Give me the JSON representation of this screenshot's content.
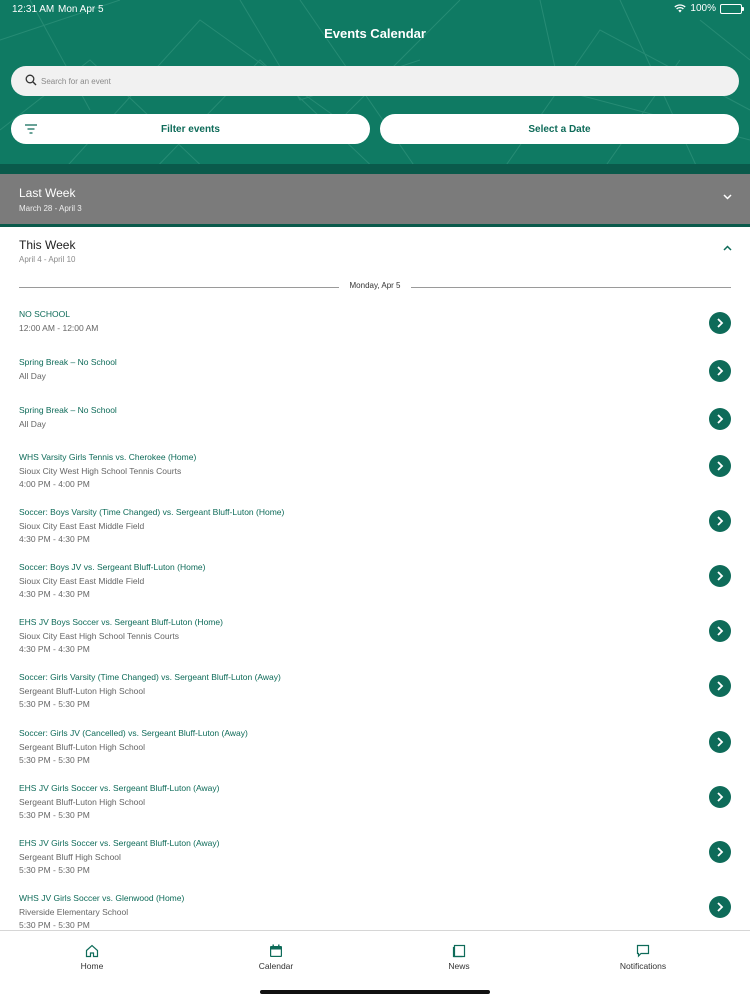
{
  "status_bar": {
    "time": "12:31 AM",
    "date": "Mon Apr 5",
    "battery": "100%"
  },
  "header": {
    "title": "Events Calendar"
  },
  "search": {
    "placeholder": "Search for an event"
  },
  "filters": {
    "filter_label": "Filter events",
    "date_label": "Select a Date"
  },
  "colors": {
    "brand": "#0f7a63",
    "accent": "#0e6b59",
    "section_collapsed": "#7b7b7b"
  },
  "sections": {
    "last_week": {
      "title": "Last Week",
      "range": "March 28 - April 3"
    },
    "this_week": {
      "title": "This Week",
      "range": "April 4 - April 10"
    }
  },
  "day_label": "Monday, Apr 5",
  "events": [
    {
      "title": "NO SCHOOL",
      "lines": [
        "12:00 AM - 12:00 AM"
      ]
    },
    {
      "title": "Spring Break – No School",
      "lines": [
        "All Day"
      ]
    },
    {
      "title": "Spring Break – No School",
      "lines": [
        "All Day"
      ]
    },
    {
      "title": "WHS Varsity Girls Tennis vs. Cherokee (Home)",
      "lines": [
        "Sioux City West High School Tennis Courts",
        "4:00 PM - 4:00 PM"
      ]
    },
    {
      "title": "Soccer: Boys Varsity  (Time Changed) vs. Sergeant Bluff-Luton (Home)",
      "lines": [
        "Sioux City East  East Middle Field",
        "4:30 PM - 4:30 PM"
      ]
    },
    {
      "title": "Soccer: Boys JV  vs. Sergeant Bluff-Luton (Home)",
      "lines": [
        "Sioux City East  East Middle Field",
        "4:30 PM - 4:30 PM"
      ]
    },
    {
      "title": "EHS JV Boys Soccer vs. Sergeant Bluff-Luton (Home)",
      "lines": [
        "Sioux City East High School Tennis Courts",
        "4:30 PM - 4:30 PM"
      ]
    },
    {
      "title": "Soccer: Girls Varsity  (Time Changed) vs. Sergeant Bluff-Luton (Away)",
      "lines": [
        "Sergeant Bluff-Luton High School",
        "5:30 PM - 5:30 PM"
      ]
    },
    {
      "title": "Soccer: Girls JV  (Cancelled) vs. Sergeant Bluff-Luton (Away)",
      "lines": [
        "Sergeant Bluff-Luton High School",
        "5:30 PM - 5:30 PM"
      ]
    },
    {
      "title": "EHS JV Girls Soccer vs. Sergeant Bluff-Luton (Away)",
      "lines": [
        "Sergeant Bluff-Luton High School",
        "5:30 PM - 5:30 PM"
      ]
    },
    {
      "title": "EHS JV Girls Soccer vs. Sergeant Bluff-Luton (Away)",
      "lines": [
        "Sergeant Bluff High School",
        "5:30 PM - 5:30 PM"
      ]
    },
    {
      "title": "WHS JV Girls Soccer vs. Glenwood (Home)",
      "lines": [
        "Riverside Elementary School",
        "5:30 PM - 5:30 PM"
      ]
    }
  ],
  "tabs": [
    {
      "label": "Home",
      "icon": "home-icon"
    },
    {
      "label": "Calendar",
      "icon": "calendar-icon"
    },
    {
      "label": "News",
      "icon": "news-icon"
    },
    {
      "label": "Notifications",
      "icon": "notifications-icon"
    }
  ]
}
